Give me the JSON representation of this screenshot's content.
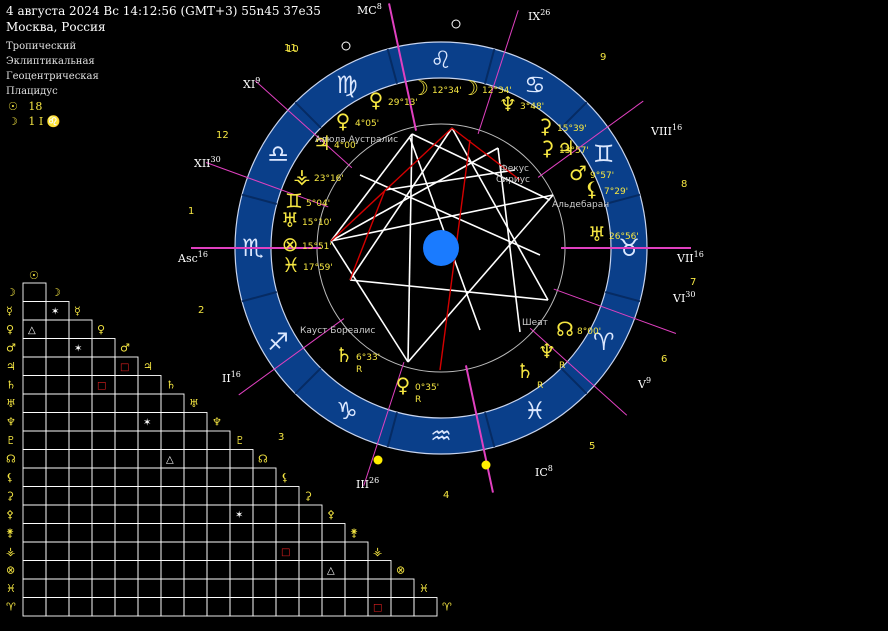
{
  "header": {
    "line1": "4 августа 2024  Вс  14:12:56 (GMT+3) 55n45  37e35",
    "line2": "Москва, Россия"
  },
  "options": [
    "Тропический",
    "Эклиптикальная",
    "Геоцентрическая",
    "Плацидус"
  ],
  "stats": {
    "sun_label": "☉",
    "sun_value": "18",
    "moon_label": "☽",
    "moon_value": "1 I ♌"
  },
  "wheel": {
    "zodiac_glyphs": [
      "♈",
      "♉",
      "♊",
      "♋",
      "♌",
      "♍",
      "♎",
      "♏",
      "♐",
      "♑",
      "♒",
      "♓"
    ],
    "houses": [
      {
        "label": "MC",
        "sup": "8"
      },
      {
        "label": "IX",
        "sup": "26"
      },
      {
        "label": "VIII",
        "sup": "16"
      },
      {
        "label": "VII",
        "sup": "16"
      },
      {
        "label": "VI",
        "sup": "30"
      },
      {
        "label": "V",
        "sup": "9"
      },
      {
        "label": "IC",
        "sup": "8"
      },
      {
        "label": "III",
        "sup": "26"
      },
      {
        "label": "II",
        "sup": "16"
      },
      {
        "label": "Asc",
        "sup": "16"
      },
      {
        "label": "XII",
        "sup": "30"
      },
      {
        "label": "XI",
        "sup": "9"
      }
    ],
    "house_numbers": [
      "10",
      "9",
      "8",
      "7",
      "6",
      "5",
      "4",
      "3",
      "2",
      "1",
      "12",
      "11"
    ],
    "planets": [
      {
        "glyph": "☽",
        "deg": "12°34'"
      },
      {
        "glyph": "☽",
        "deg": "12°34'"
      },
      {
        "glyph": "♀",
        "deg": "29°13'"
      },
      {
        "glyph": "♀",
        "deg": "4°05'"
      },
      {
        "glyph": "♃",
        "deg": "4°00'"
      },
      {
        "glyph": "♆",
        "deg": "3°48'"
      },
      {
        "glyph": "⚳",
        "deg": "15°39'"
      },
      {
        "glyph": "⚳",
        "deg": "13°57'"
      },
      {
        "glyph": "♃",
        "deg": ""
      },
      {
        "glyph": "♂",
        "deg": "9°57'"
      },
      {
        "glyph": "⚸",
        "deg": "7°29'"
      },
      {
        "glyph": "♅",
        "deg": "26°56'"
      },
      {
        "glyph": "⚶",
        "deg": "23°16'"
      },
      {
        "glyph": "♊",
        "deg": "5°04'"
      },
      {
        "glyph": "♅",
        "deg": "15°10'"
      },
      {
        "glyph": "⊗",
        "deg": "15°51'"
      },
      {
        "glyph": "♓",
        "deg": "17°59'"
      },
      {
        "glyph": "♄",
        "deg": "6°33'",
        "retro": "R"
      },
      {
        "glyph": "♀",
        "deg": "0°35'",
        "retro": "R"
      },
      {
        "glyph": "☊",
        "deg": "8°00'"
      },
      {
        "glyph": "♆",
        "deg": "",
        "retro": "R"
      },
      {
        "glyph": "♄",
        "deg": "",
        "retro": "R"
      }
    ],
    "stars": [
      "Алюла Аустралис",
      "Фекус",
      "Сириус",
      "Альдебаран",
      "Кауст Бореалис",
      "Шеат"
    ]
  },
  "grid": {
    "column_glyphs": [
      "☉",
      "☽",
      "☿",
      "♀",
      "♂",
      "♃",
      "♄",
      "♅",
      "♆",
      "♇",
      "☊",
      "⚸",
      "⚳",
      "⚴",
      "⚵",
      "⚶",
      "⊗",
      "♓",
      "♈"
    ],
    "row_glyphs": [
      "☽",
      "☿",
      "♀",
      "♂",
      "♃",
      "♄",
      "♅",
      "♆",
      "♇",
      "☊",
      "⚸",
      "⚳",
      "⚴",
      "⚵",
      "⚶",
      "⊗",
      "♓",
      "♈"
    ]
  },
  "colors": {
    "background": "#000000",
    "ring": "#0a3f8a",
    "ring_dark": "#062b63",
    "glyph": "#f5e642",
    "house_line": "#e040c0",
    "center": "#1a7bff",
    "aspect_white": "#ffffff",
    "aspect_red": "#d40000"
  }
}
